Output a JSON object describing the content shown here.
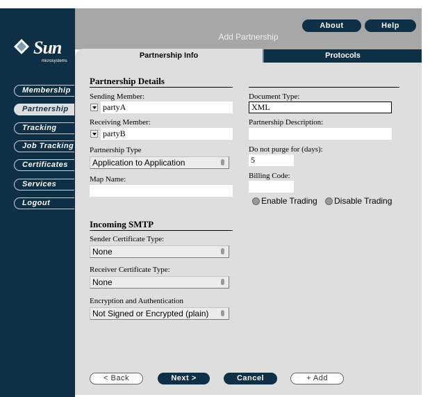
{
  "brand": {
    "word": "Sun",
    "sub": "microsystems"
  },
  "header": {
    "title": "Add Partnership",
    "about_label": "About",
    "help_label": "Help"
  },
  "nav": {
    "membership": "Membership",
    "partnership": "Partnership",
    "tracking": "Tracking",
    "job_tracking": "Job Tracking",
    "certificates": "Certificates",
    "services": "Services",
    "logout": "Logout"
  },
  "tabs": {
    "info": "Partnership Info",
    "protocols": "Protocols"
  },
  "details": {
    "title": "Partnership Details",
    "sending_label": "Sending Member:",
    "sending_value": "partyA",
    "receiving_label": "Receiving Member:",
    "receiving_value": "partyB",
    "type_label": "Partnership Type",
    "type_value": "Application to Application",
    "map_label": "Map Name:",
    "map_value": "",
    "doc_type_label": "Document Type:",
    "doc_type_value": "XML",
    "desc_label": "Partnership Description:",
    "desc_value": "",
    "purge_label": "Do not purge for (days):",
    "purge_value": "5",
    "billing_label": "Billing Code:",
    "billing_value": "",
    "enable_label": "Enable Trading",
    "disable_label": "Disable Trading"
  },
  "smtp": {
    "title": "Incoming SMTP",
    "sender_label": "Sender Certificate Type:",
    "sender_value": "None",
    "receiver_label": "Receiver Certificate Type:",
    "receiver_value": "None",
    "enc_label": "Encryption and Authentication",
    "enc_value": "Not Signed or Encrypted (plain)"
  },
  "buttons": {
    "back": "< Back",
    "next": "Next >",
    "cancel": "Cancel",
    "add": "+ Add"
  },
  "colors": {
    "navy": "#0e3047",
    "panel": "#dedede",
    "header": "#a7a7a7"
  }
}
